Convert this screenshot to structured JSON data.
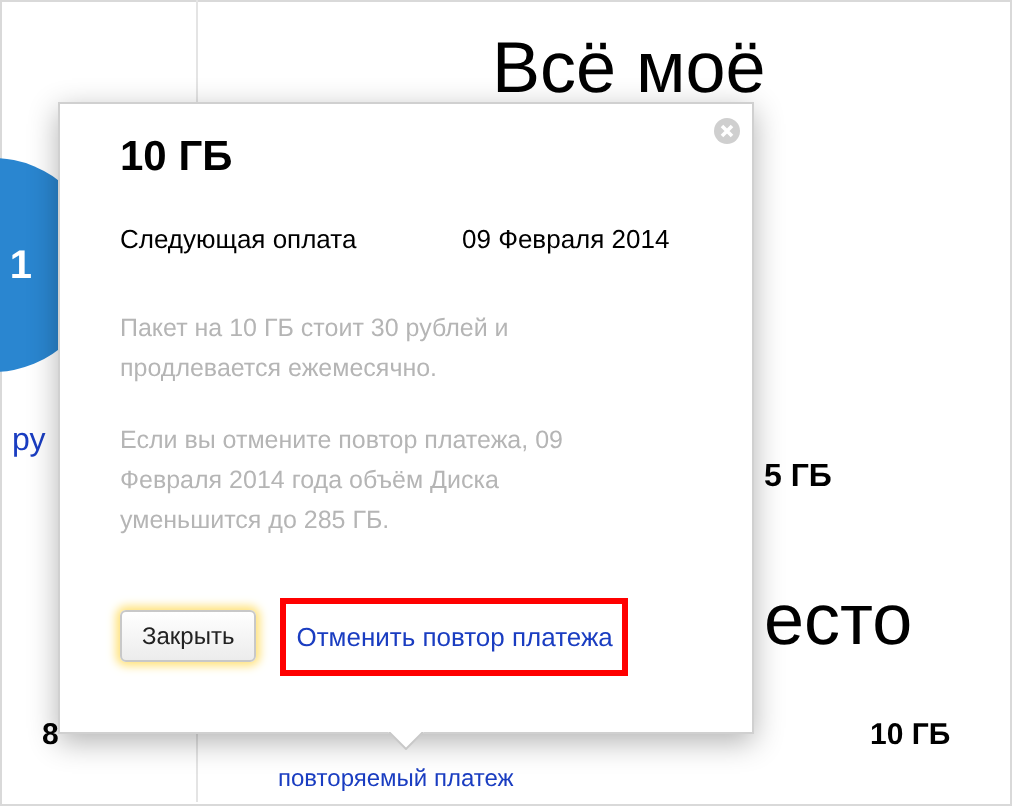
{
  "background": {
    "heading": "Всё моё",
    "plan_badge": "1",
    "link_fragment": "ру",
    "size_fragment": "5 ГБ",
    "section_fragment": "есто",
    "left_size_fragment": "8",
    "right_size": "10 ГБ",
    "recurring_link": "повторяемый платеж"
  },
  "popup": {
    "title": "10 ГБ",
    "next_payment_label": "Следующая оплата",
    "next_payment_date": "09 Февраля 2014",
    "paragraphs": [
      "Пакет на 10 ГБ стоит 30 рублей и продлевается ежемесячно.",
      "Если вы отмените повтор платежа, 09 Февраля 2014 года объём Диска уменьшится до 285 ГБ."
    ],
    "close_button": "Закрыть",
    "cancel_link": "Отменить повтор платежа",
    "cancel_link_highlighted": true
  }
}
